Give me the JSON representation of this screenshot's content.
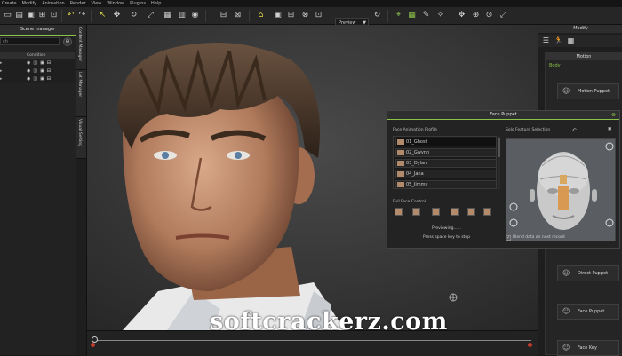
{
  "menu": [
    "Create",
    "Modify",
    "Animation",
    "Render",
    "View",
    "Window",
    "Plugins",
    "Help"
  ],
  "toolbar": {
    "preview_mode": "Preview"
  },
  "scene_manager": {
    "title": "Scene manager",
    "search_placeholder": "ch",
    "column_condition": "Condition"
  },
  "side_tabs": [
    "Content Manager",
    "Lot Manager",
    "Visual Setting"
  ],
  "modify_panel": {
    "title": "Modify",
    "section_title": "Motion",
    "body_label": "Body",
    "buttons": [
      "Motion Puppet",
      "Direct Puppet",
      "Face Puppet",
      "Face Key"
    ]
  },
  "face_puppet": {
    "title": "Face Puppet",
    "profile_label": "Face Animation Profile",
    "profiles": [
      "01_Ghost",
      "02_Gwynn",
      "03_Dylan",
      "04_Jana",
      "05_Jimmy"
    ],
    "selected_profile": "01_Ghost",
    "solo_label": "Solo Feature Selection",
    "full_face_label": "Full Face Control",
    "previewing": "Previewing......",
    "hint": "Press space key to stop",
    "blend_label": "Blend data on next record",
    "blend_checked": true
  },
  "watermark": "softcrackerz.com",
  "colors": {
    "accent": "#8bc34a",
    "panel": "#232323",
    "timeline_marker": "#c0392b"
  }
}
